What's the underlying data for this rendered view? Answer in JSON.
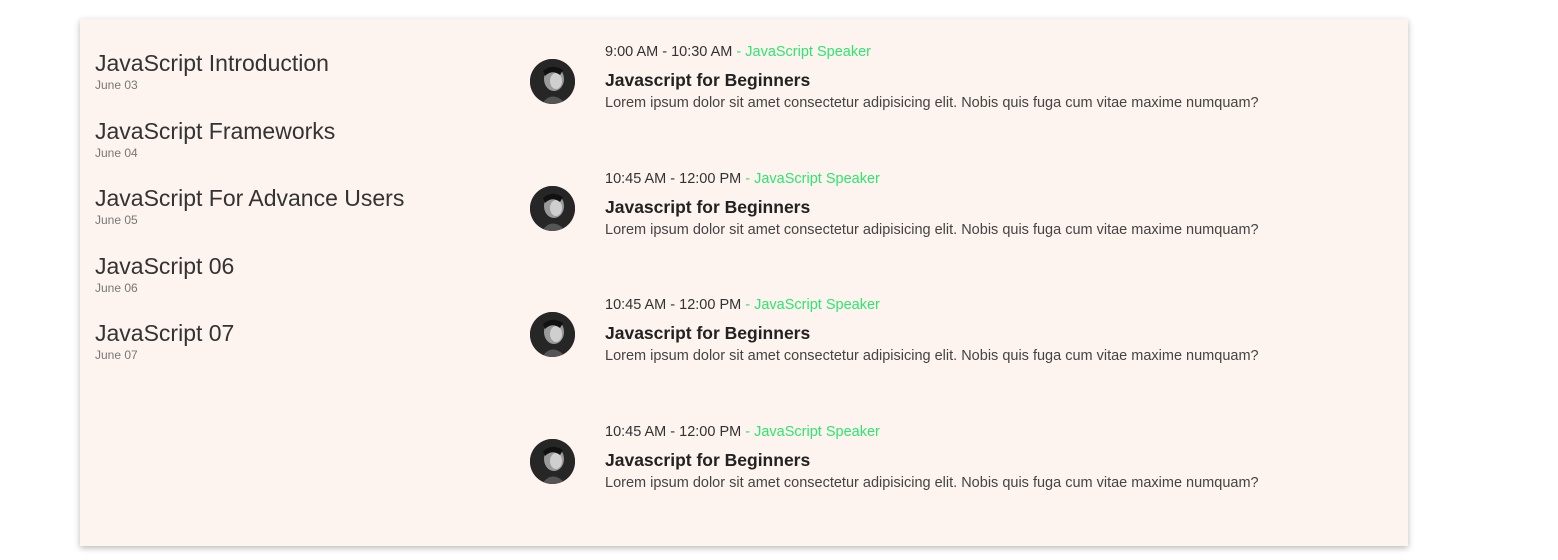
{
  "days": [
    {
      "title": "JavaScript Introduction",
      "date": "June 03"
    },
    {
      "title": "JavaScript Frameworks",
      "date": "June 04"
    },
    {
      "title": "JavaScript For Advance Users",
      "date": "June 05"
    },
    {
      "title": "JavaScript 06",
      "date": "June 06"
    },
    {
      "title": "JavaScript 07",
      "date": "June 07"
    }
  ],
  "sessions": [
    {
      "time": "9:00 AM - 10:30 AM",
      "speaker": "JavaScript Speaker",
      "title": "Javascript for Beginners",
      "description": "Lorem ipsum dolor sit amet consectetur adipisicing elit. Nobis quis fuga cum vitae maxime numquam?"
    },
    {
      "time": "10:45 AM - 12:00 PM",
      "speaker": "JavaScript Speaker",
      "title": "Javascript for Beginners",
      "description": "Lorem ipsum dolor sit amet consectetur adipisicing elit. Nobis quis fuga cum vitae maxime numquam?"
    },
    {
      "time": "10:45 AM - 12:00 PM",
      "speaker": "JavaScript Speaker",
      "title": "Javascript for Beginners",
      "description": "Lorem ipsum dolor sit amet consectetur adipisicing elit. Nobis quis fuga cum vitae maxime numquam?"
    },
    {
      "time": "10:45 AM - 12:00 PM",
      "speaker": "JavaScript Speaker",
      "title": "Javascript for Beginners",
      "description": "Lorem ipsum dolor sit amet consectetur adipisicing elit. Nobis quis fuga cum vitae maxime numquam?"
    }
  ],
  "separator": " - ",
  "colors": {
    "card_background": "#fdf3ef",
    "speaker_accent": "#2ee66e"
  }
}
